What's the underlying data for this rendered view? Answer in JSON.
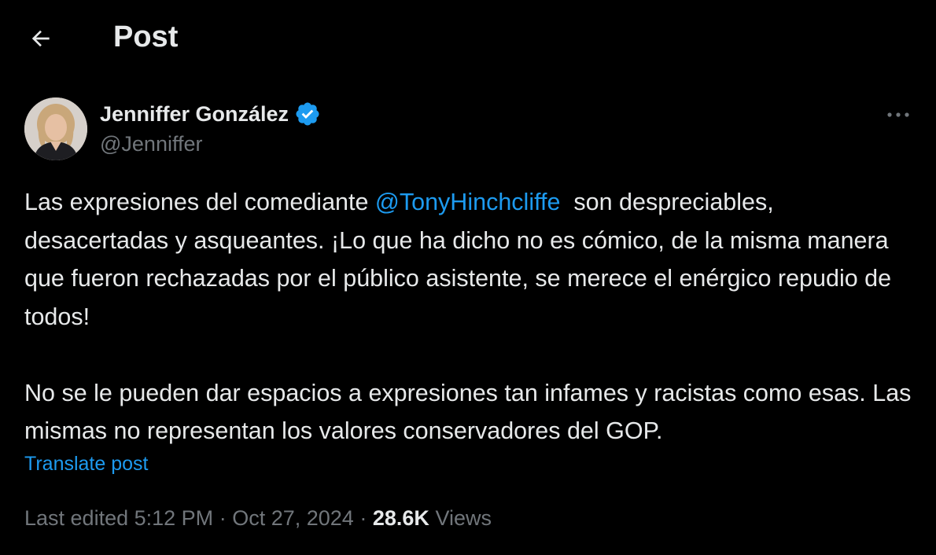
{
  "header": {
    "title": "Post",
    "back_icon": "arrow-left-icon"
  },
  "post": {
    "author": {
      "name": "Jenniffer González",
      "handle": "@Jenniffer",
      "verified": true,
      "verified_color": "#1d9bf0"
    },
    "text": {
      "part1": "Las expresiones del comediante ",
      "mention": "@TonyHinchcliffe",
      "part2": "  son despreciables, desacertadas y asqueantes. ¡Lo que ha dicho no es cómico, de la misma manera que fueron rechazadas por el público asistente, se merece el enérgico repudio de todos!\n\nNo se le pueden dar espacios a expresiones tan infames y racistas como esas. Las mismas no representan los valores conservadores del GOP."
    },
    "translate_label": "Translate post",
    "meta": {
      "edited_label": "Last edited",
      "time": "5:12 PM",
      "separator": "·",
      "date": "Oct 27, 2024",
      "views_count": "28.6K",
      "views_label": "Views"
    }
  },
  "colors": {
    "background": "#000000",
    "text_primary": "#e7e9ea",
    "text_secondary": "#71767b",
    "accent": "#1d9bf0"
  }
}
